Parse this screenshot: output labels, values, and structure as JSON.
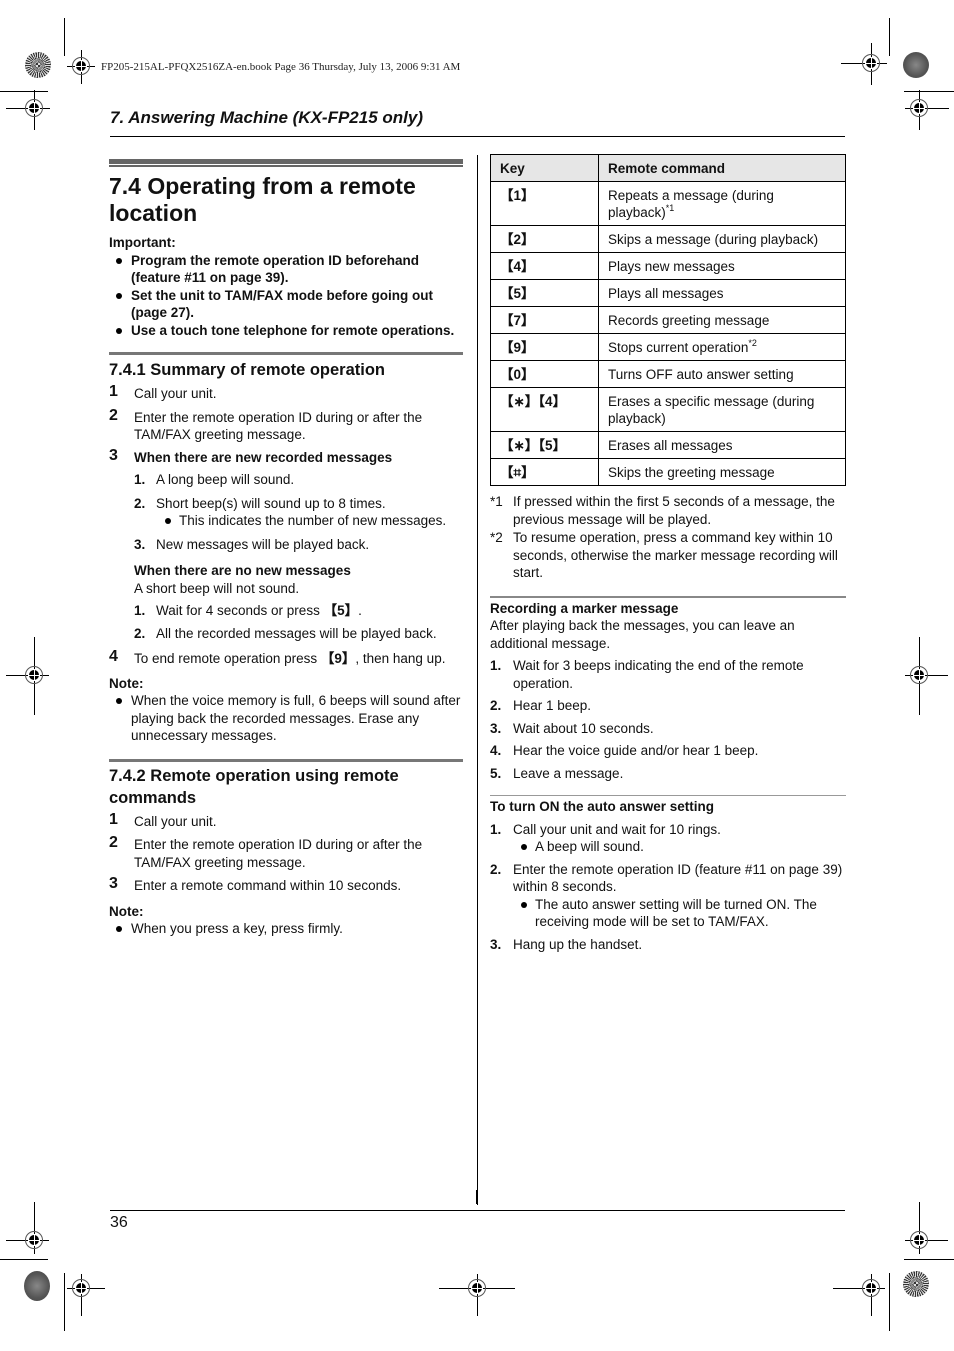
{
  "print_header": "FP205-215AL-PFQX2516ZA-en.book  Page 36  Thursday, July 13, 2006  9:31 AM",
  "chapter_title": "7. Answering Machine (KX-FP215 only)",
  "page_number": "36",
  "left": {
    "title": "7.4 Operating from a remote location",
    "important_label": "Important:",
    "important_items": [
      "Program the remote operation ID beforehand (feature #11 on page 39).",
      "Set the unit to TAM/FAX mode before going out (page 27).",
      "Use a touch tone telephone for remote operations."
    ],
    "sec1": {
      "title": "7.4.1 Summary of remote operation",
      "steps": [
        {
          "num": "1",
          "text": "Call your unit."
        },
        {
          "num": "2",
          "text": "Enter the remote operation ID during or after the TAM/FAX greeting message."
        },
        {
          "num": "3",
          "text": "When there are new recorded messages"
        }
      ],
      "new_msgs": [
        {
          "num": "1.",
          "text": "A long beep will sound."
        },
        {
          "num": "2.",
          "text": "Short beep(s) will sound up to 8 times."
        },
        {
          "num": "3.",
          "text": "New messages will be played back."
        }
      ],
      "new_msgs_bullet": "This indicates the number of new messages.",
      "no_new_title": "When there are no new messages",
      "no_new_text": "A short beep will not sound.",
      "no_new_steps": [
        {
          "num": "1.",
          "pre": "Wait for 4 seconds or press ",
          "key": "【5】",
          "post": "."
        },
        {
          "num": "2.",
          "text": "All the recorded messages will be played back."
        }
      ],
      "step4": {
        "num": "4",
        "pre": "To end remote operation press ",
        "key": "【9】",
        "post": ", then hang up."
      },
      "note_label": "Note:",
      "note": "When the voice memory is full, 6 beeps will sound after playing back the recorded messages. Erase any unnecessary messages."
    },
    "sec2": {
      "title": "7.4.2 Remote operation using remote commands",
      "steps": [
        {
          "num": "1",
          "text": "Call your unit."
        },
        {
          "num": "2",
          "text": "Enter the remote operation ID during or after the TAM/FAX greeting message."
        },
        {
          "num": "3",
          "text": "Enter a remote command within 10 seconds."
        }
      ],
      "note_label": "Note:",
      "note": "When you press a key, press firmly."
    }
  },
  "right": {
    "table": {
      "headers": [
        "Key",
        "Remote command"
      ],
      "rows": [
        {
          "key": "【1】",
          "cmd": "Repeats a message (during playback)",
          "sup": "*1"
        },
        {
          "key": "【2】",
          "cmd": "Skips a message (during playback)",
          "sup": ""
        },
        {
          "key": "【4】",
          "cmd": "Plays new messages",
          "sup": ""
        },
        {
          "key": "【5】",
          "cmd": "Plays all messages",
          "sup": ""
        },
        {
          "key": "【7】",
          "cmd": "Records greeting message",
          "sup": ""
        },
        {
          "key": "【9】",
          "cmd": "Stops current operation",
          "sup": "*2"
        },
        {
          "key": "【0】",
          "cmd": "Turns OFF auto answer setting",
          "sup": ""
        },
        {
          "key": "【∗】【4】",
          "cmd": "Erases a specific message (during playback)",
          "sup": ""
        },
        {
          "key": "【∗】【5】",
          "cmd": "Erases all messages",
          "sup": ""
        },
        {
          "key": "【⌗】",
          "cmd": "Skips the greeting message",
          "sup": ""
        }
      ]
    },
    "footnotes": [
      {
        "mark": "*1",
        "text": "If pressed within the first 5 seconds of a message, the previous message will be played."
      },
      {
        "mark": "*2",
        "text": "To resume operation, press a command key within 10 seconds, otherwise the marker message recording will start."
      }
    ],
    "marker": {
      "title": "Recording a marker message",
      "intro": "After playing back the messages, you can leave an additional message.",
      "steps": [
        {
          "num": "1.",
          "text": "Wait for 3 beeps indicating the end of the remote operation."
        },
        {
          "num": "2.",
          "text": "Hear 1 beep."
        },
        {
          "num": "3.",
          "text": "Wait about 10 seconds."
        },
        {
          "num": "4.",
          "text": "Hear the voice guide and/or hear 1 beep."
        },
        {
          "num": "5.",
          "text": "Leave a message."
        }
      ]
    },
    "auto": {
      "title": "To turn ON the auto answer setting",
      "steps": [
        {
          "num": "1.",
          "text": "Call your unit and wait for 10 rings.",
          "bullet": "A beep will sound."
        },
        {
          "num": "2.",
          "text": "Enter the remote operation ID (feature #11 on page 39) within 8 seconds.",
          "bullet": "The auto answer setting will be turned ON. The receiving mode will be set to TAM/FAX."
        },
        {
          "num": "3.",
          "text": "Hang up the handset.",
          "bullet": ""
        }
      ]
    }
  }
}
